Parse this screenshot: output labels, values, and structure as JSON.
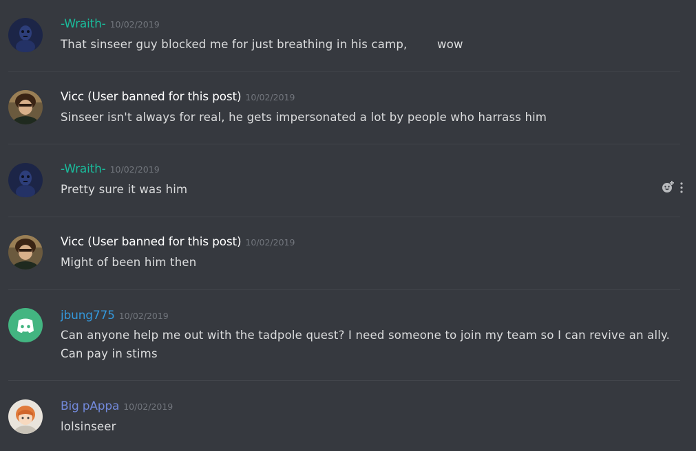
{
  "colors": {
    "background": "#36393f",
    "text": "#dcddde",
    "timestamp": "#72767d",
    "divider": "#42454b",
    "teal": "#1abc9c",
    "white": "#ffffff",
    "blue": "#3498db",
    "blurple": "#7289da",
    "discord_green": "#43b581"
  },
  "messages": [
    {
      "username": "-Wraith-",
      "timestamp": "10/02/2019",
      "lines": [
        "That sinseer guy blocked me for just breathing in his camp,        wow"
      ],
      "avatar": "dark-creature-avatar"
    },
    {
      "username": "Vicc (User banned for this post)",
      "timestamp": "10/02/2019",
      "lines": [
        "Sinseer isn't always for real, he gets impersonated a lot by people who harrass him"
      ],
      "avatar": "person-photo-avatar"
    },
    {
      "username": "-Wraith-",
      "timestamp": "10/02/2019",
      "lines": [
        "Pretty sure it was him"
      ],
      "avatar": "dark-creature-avatar"
    },
    {
      "username": "Vicc (User banned for this post)",
      "timestamp": "10/02/2019",
      "lines": [
        "Might of been him then"
      ],
      "avatar": "person-photo-avatar"
    },
    {
      "username": "jbung775",
      "timestamp": "10/02/2019",
      "lines": [
        "Can anyone help me out with the tadpole quest? I need someone to join my team so I can revive an ally.",
        "Can pay in stims"
      ],
      "avatar": "discord-default-avatar"
    },
    {
      "username": "Big pAppa",
      "timestamp": "10/02/2019",
      "lines": [
        "lolsinseer"
      ],
      "avatar": "anime-girl-avatar"
    }
  ],
  "hover_actions": [
    "add-reaction-icon",
    "more-options-icon"
  ]
}
